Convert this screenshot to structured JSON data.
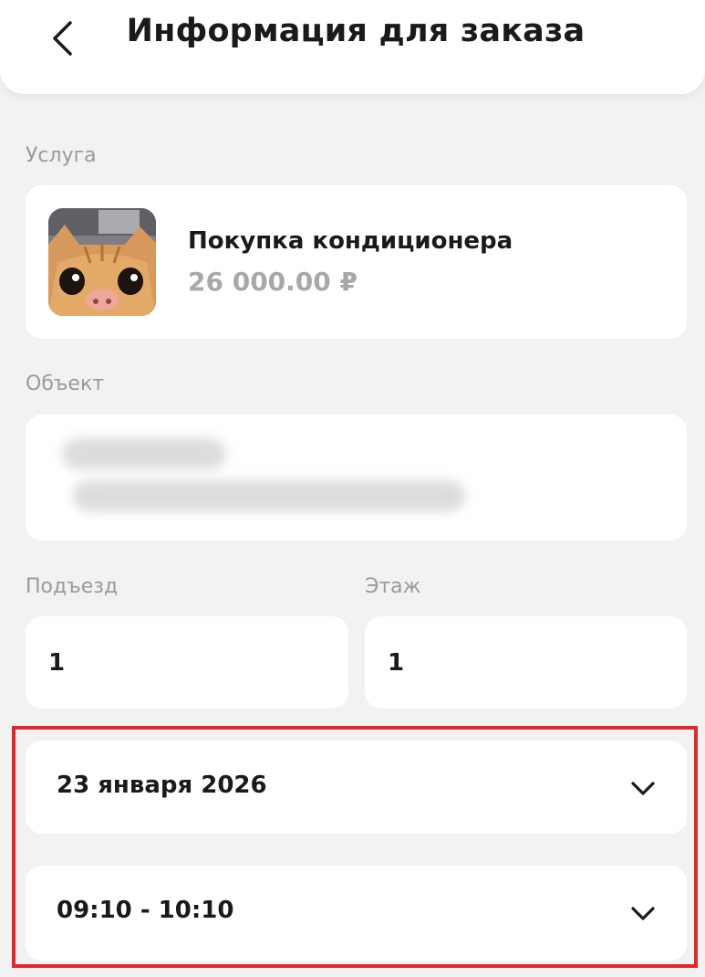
{
  "header": {
    "title": "Информация для заказа",
    "back_icon": "chevron-left-icon"
  },
  "service": {
    "section_label": "Услуга",
    "name": "Покупка кондиционера",
    "price": "26 000.00 ₽",
    "image": "cat-photo"
  },
  "object": {
    "section_label": "Объект"
  },
  "entrance": {
    "label": "Подъезд",
    "value": "1"
  },
  "floor": {
    "label": "Этаж",
    "value": "1"
  },
  "date_select": {
    "value": "23 января 2026",
    "icon": "chevron-down-icon"
  },
  "time_select": {
    "value": "09:10 - 10:10",
    "icon": "chevron-down-icon"
  },
  "colors": {
    "background": "#f2f2f2",
    "card": "#ffffff",
    "label_gray": "#9a9a9a",
    "price_gray": "#a8a8a8",
    "highlight_red": "#e2262b"
  }
}
